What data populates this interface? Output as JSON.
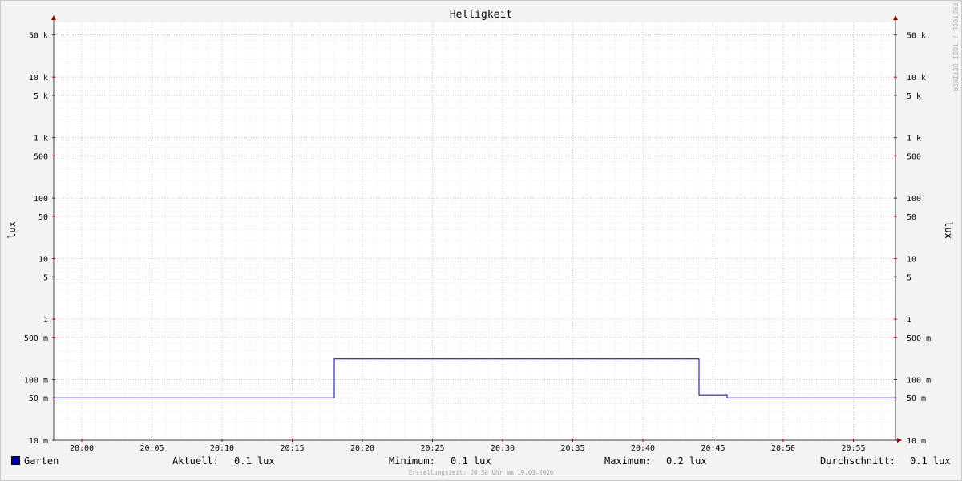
{
  "chart_data": {
    "type": "line",
    "title": "Helligkeit",
    "ylabel": "lux",
    "ylabel_right": "lux",
    "yscale": "log",
    "ylim": [
      0.01,
      80000
    ],
    "xlim": [
      "19:58",
      "20:58"
    ],
    "x_ticks": [
      "20:00",
      "20:05",
      "20:10",
      "20:15",
      "20:20",
      "20:25",
      "20:30",
      "20:35",
      "20:40",
      "20:45",
      "20:50",
      "20:55"
    ],
    "y_ticks": [
      {
        "value": 50000,
        "label": "50 k"
      },
      {
        "value": 10000,
        "label": "10 k"
      },
      {
        "value": 5000,
        "label": "5 k"
      },
      {
        "value": 1000,
        "label": "1 k"
      },
      {
        "value": 500,
        "label": "500"
      },
      {
        "value": 100,
        "label": "100"
      },
      {
        "value": 50,
        "label": "50"
      },
      {
        "value": 10,
        "label": "10"
      },
      {
        "value": 5,
        "label": "5"
      },
      {
        "value": 1,
        "label": "1"
      },
      {
        "value": 0.5,
        "label": "500 m"
      },
      {
        "value": 0.1,
        "label": "100 m"
      },
      {
        "value": 0.05,
        "label": "50 m"
      },
      {
        "value": 0.01,
        "label": "10 m"
      }
    ],
    "grid": true,
    "series": [
      {
        "name": "Garten",
        "color": "#000099",
        "step": true,
        "points": [
          {
            "x": "19:58",
            "y": 0.05
          },
          {
            "x": "20:18",
            "y": 0.05
          },
          {
            "x": "20:18",
            "y": 0.22
          },
          {
            "x": "20:44",
            "y": 0.22
          },
          {
            "x": "20:44",
            "y": 0.055
          },
          {
            "x": "20:46",
            "y": 0.055
          },
          {
            "x": "20:46",
            "y": 0.05
          },
          {
            "x": "20:58",
            "y": 0.05
          }
        ]
      }
    ]
  },
  "watermark": "RRDTOOL / TOBI OETIKER",
  "legend": {
    "series_name": "Garten",
    "aktuell_label": "Aktuell:",
    "aktuell_value": "0.1 lux",
    "minimum_label": "Minimum:",
    "minimum_value": "0.1 lux",
    "maximum_label": "Maximum:",
    "maximum_value": "0.2 lux",
    "durchschnitt_label": "Durchschnitt:",
    "durchschnitt_value": "0.1 lux"
  },
  "footer": "Erstellungszeit: 20:58 Uhr am 19.03.2026"
}
